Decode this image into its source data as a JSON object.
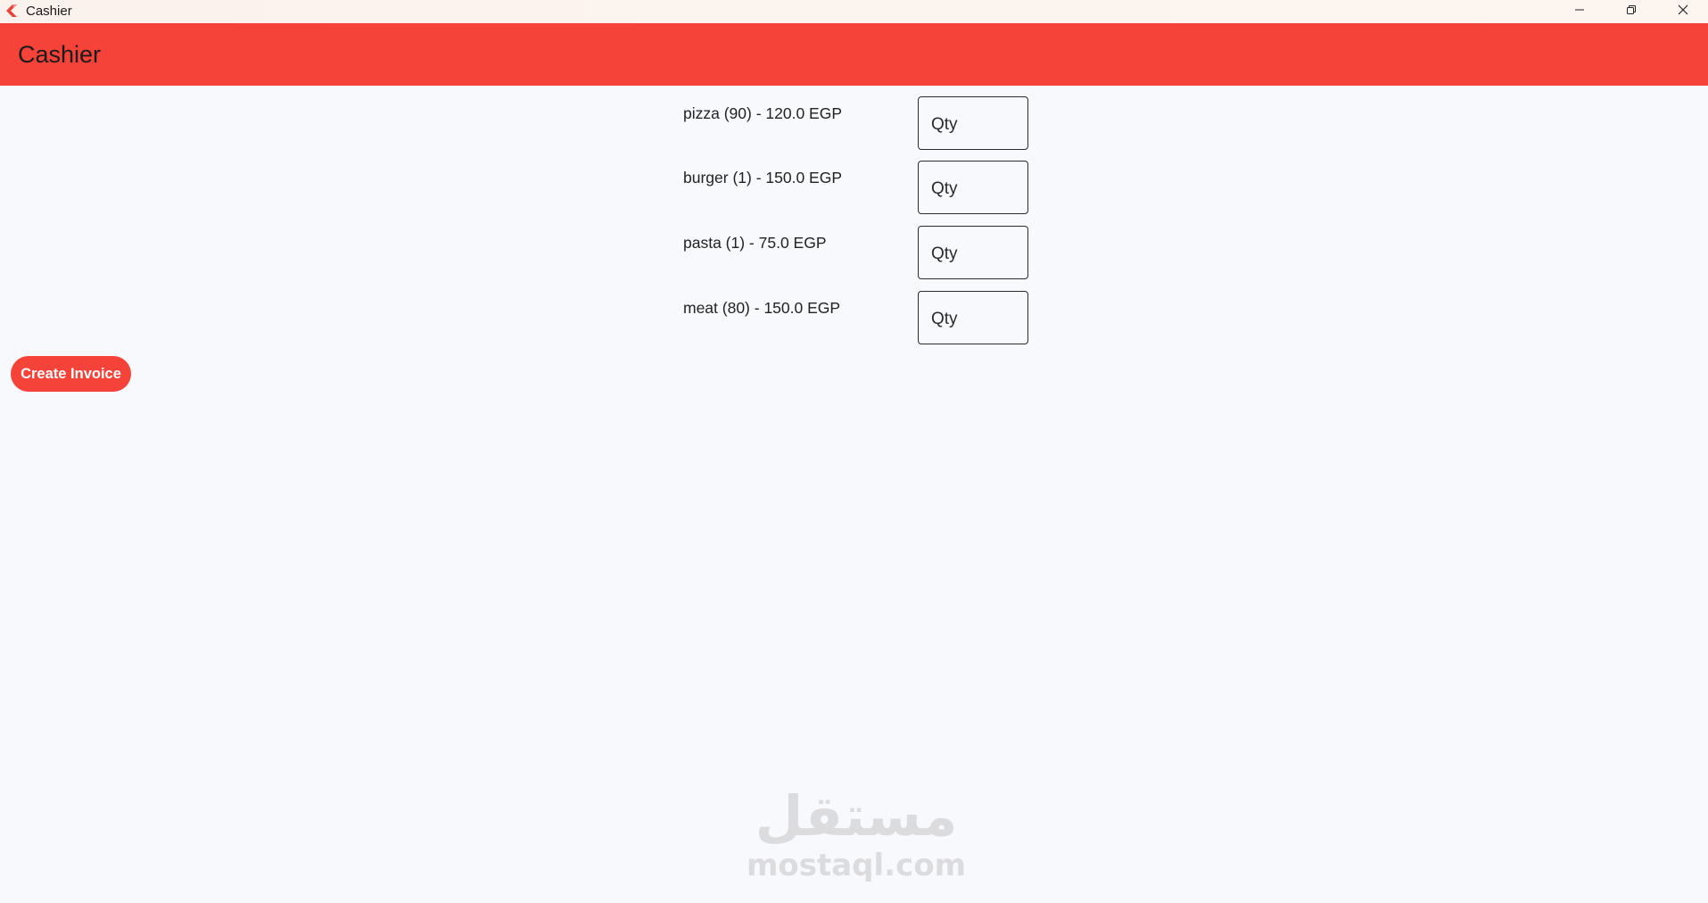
{
  "window": {
    "title": "Cashier",
    "controls": {
      "minimize_icon": "minimize-icon",
      "restore_icon": "restore-icon",
      "close_icon": "close-icon"
    }
  },
  "appbar": {
    "title": "Cashier",
    "color": "#f5433a"
  },
  "products": [
    {
      "label": "pizza (90) - 120.0 EGP",
      "qty_placeholder": "Qty",
      "qty_value": ""
    },
    {
      "label": "burger (1) - 150.0 EGP",
      "qty_placeholder": "Qty",
      "qty_value": ""
    },
    {
      "label": "pasta (1) - 75.0 EGP",
      "qty_placeholder": "Qty",
      "qty_value": ""
    },
    {
      "label": "meat (80) - 150.0 EGP",
      "qty_placeholder": "Qty",
      "qty_value": ""
    }
  ],
  "actions": {
    "create_invoice_label": "Create Invoice"
  },
  "watermark": {
    "arabic": "مستقل",
    "latin": "mostaql.com"
  }
}
